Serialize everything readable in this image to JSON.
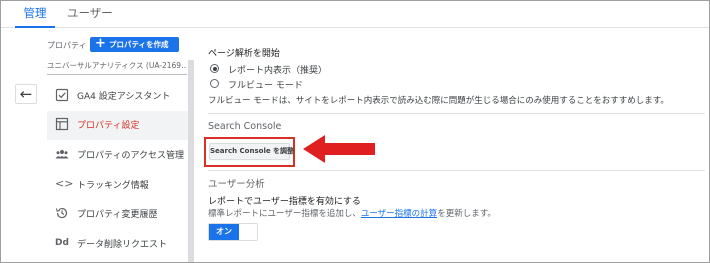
{
  "tabs": [
    {
      "label": "管理",
      "active": true
    },
    {
      "label": "ユーザー",
      "active": false
    }
  ],
  "sidebar": {
    "property_label": "プロパティ",
    "create_button": "プロパティを作成",
    "property_name": "ユニバーサルアナリティクス (UA-2169…",
    "items": [
      {
        "label": "GA4 設定アシスタント",
        "icon": "check-box-icon",
        "active": false
      },
      {
        "label": "プロパティ設定",
        "icon": "settings-layout-icon",
        "active": true
      },
      {
        "label": "プロパティのアクセス管理",
        "icon": "people-icon",
        "active": false
      },
      {
        "label": "トラッキング情報",
        "icon": "code-icon",
        "active": false
      },
      {
        "label": "プロパティ変更履歴",
        "icon": "history-icon",
        "active": false
      },
      {
        "label": "データ削除リクエスト",
        "icon": "dd-icon",
        "active": false
      }
    ]
  },
  "main": {
    "page_analysis_title": "ページ解析を開始",
    "radio_options": [
      {
        "label": "レポート内表示（推奨）",
        "selected": true
      },
      {
        "label": "フルビュー モード",
        "selected": false
      }
    ],
    "full_view_note": "フルビュー モードは、サイトをレポート内表示で読み込む際に問題が生じる場合にのみ使用することをおすすめします。",
    "search_console_heading": "Search Console",
    "search_console_button": "Search Console を調整",
    "user_analysis_heading": "ユーザー分析",
    "user_metrics_title": "レポートでユーザー指標を有効にする",
    "user_metrics_desc_prefix": "標準レポートにユーザー指標を追加し、",
    "user_metrics_link": "ユーザー指標の計算",
    "user_metrics_desc_suffix": "を更新します。",
    "toggle_label": "オン"
  },
  "colors": {
    "accent": "#1a73e8",
    "highlight": "#d93025"
  }
}
